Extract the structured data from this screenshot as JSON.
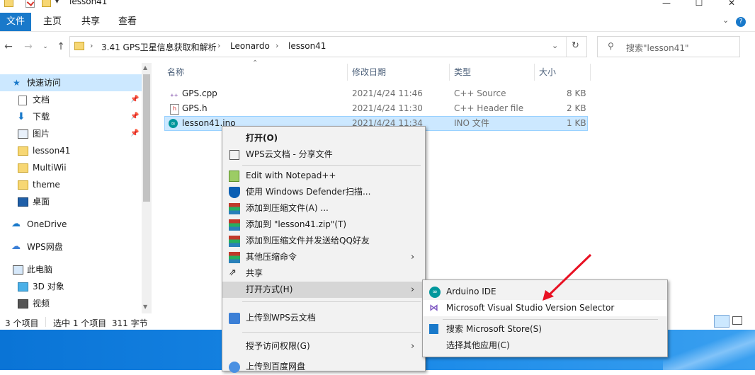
{
  "window": {
    "title": "lesson41",
    "controls": {
      "minimize": "—",
      "maximize": "☐",
      "close": "✕"
    }
  },
  "ribbon": {
    "tabs": [
      "文件",
      "主页",
      "共享",
      "查看"
    ],
    "expand_icon": "chevron-down-icon",
    "help": "?"
  },
  "address": {
    "breadcrumbs": [
      "3.41 GPS卫星信息获取和解析",
      "Leonardo",
      "lesson41"
    ],
    "search_placeholder": "搜索\"lesson41\""
  },
  "nav": {
    "quick_access": "快速访问",
    "items": [
      {
        "label": "文档",
        "pinned": true
      },
      {
        "label": "下载",
        "pinned": true
      },
      {
        "label": "图片",
        "pinned": true
      },
      {
        "label": "lesson41",
        "pinned": false
      },
      {
        "label": "MultiWii",
        "pinned": false
      },
      {
        "label": "theme",
        "pinned": false
      },
      {
        "label": "桌面",
        "pinned": false
      }
    ],
    "onedrive": "OneDrive",
    "wps": "WPS网盘",
    "this_pc": "此电脑",
    "pc_items": [
      "3D 对象",
      "视频"
    ]
  },
  "columns": {
    "name": "名称",
    "date": "修改日期",
    "type": "类型",
    "size": "大小"
  },
  "files": [
    {
      "name": "GPS.cpp",
      "date": "2021/4/24 11:46",
      "type": "C++ Source",
      "size": "8 KB"
    },
    {
      "name": "GPS.h",
      "date": "2021/4/24 11:30",
      "type": "C++ Header file",
      "size": "2 KB"
    },
    {
      "name": "lesson41.ino",
      "date": "2021/4/24 11:34",
      "type": "INO 文件",
      "size": "1 KB"
    }
  ],
  "context_menu": {
    "open": "打开(O)",
    "wps_share": "WPS云文档 - 分享文件",
    "notepad": "Edit with Notepad++",
    "defender": "使用 Windows Defender扫描...",
    "add_archive": "添加到压缩文件(A) ...",
    "add_zip": "添加到 \"lesson41.zip\"(T)",
    "add_send_qq": "添加到压缩文件并发送给QQ好友",
    "other_compress": "其他压缩命令",
    "share": "共享",
    "open_with": "打开方式(H)",
    "upload_wps": "上传到WPS云文档",
    "grant_access": "授予访问权限(G)",
    "upload_baidu": "上传到百度网盘"
  },
  "open_with_menu": {
    "arduino": "Arduino IDE",
    "vs_selector": "Microsoft Visual Studio Version Selector",
    "store": "搜索 Microsoft Store(S)",
    "choose_other": "选择其他应用(C)"
  },
  "status": {
    "count": "3 个项目",
    "selected": "选中 1 个项目  311 字节"
  },
  "colors": {
    "accent": "#1979ca",
    "selection": "#cce8ff",
    "menu_bg": "#f2f2f2",
    "arrow": "#e81123"
  }
}
